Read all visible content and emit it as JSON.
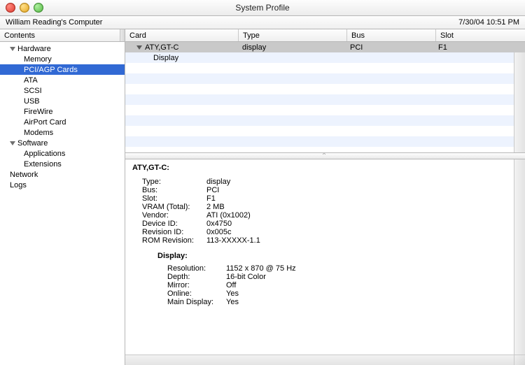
{
  "window": {
    "title": "System Profile"
  },
  "header": {
    "computer_name": "William Reading's Computer",
    "timestamp": "7/30/04 10:51 PM"
  },
  "sidebar": {
    "header": "Contents",
    "groups": [
      {
        "label": "Hardware",
        "items": [
          "Memory",
          "PCI/AGP Cards",
          "ATA",
          "SCSI",
          "USB",
          "FireWire",
          "AirPort Card",
          "Modems"
        ]
      },
      {
        "label": "Software",
        "items": [
          "Applications",
          "Extensions"
        ]
      }
    ],
    "extras": [
      "Network",
      "Logs"
    ]
  },
  "table": {
    "columns": {
      "card": "Card",
      "type": "Type",
      "bus": "Bus",
      "slot": "Slot"
    },
    "rows": [
      {
        "card": "ATY,GT-C",
        "type": "display",
        "bus": "PCI",
        "slot": "F1"
      }
    ],
    "child_label": "Display"
  },
  "detail": {
    "title": "ATY,GT-C:",
    "kv": {
      "type_k": "Type:",
      "type_v": "display",
      "bus_k": "Bus:",
      "bus_v": "PCI",
      "slot_k": "Slot:",
      "slot_v": "F1",
      "vram_k": "VRAM (Total):",
      "vram_v": "2 MB",
      "vendor_k": "Vendor:",
      "vendor_v": "ATI (0x1002)",
      "devid_k": "Device ID:",
      "devid_v": "0x4750",
      "revid_k": "Revision ID:",
      "revid_v": "0x005c",
      "romrev_k": "ROM Revision:",
      "romrev_v": "113-XXXXX-1.1"
    },
    "display": {
      "heading": "Display:",
      "res_k": "Resolution:",
      "res_v": "1152 x 870 @ 75 Hz",
      "depth_k": "Depth:",
      "depth_v": "16-bit Color",
      "mirror_k": "Mirror:",
      "mirror_v": "Off",
      "online_k": "Online:",
      "online_v": "Yes",
      "main_k": "Main Display:",
      "main_v": "Yes"
    }
  }
}
